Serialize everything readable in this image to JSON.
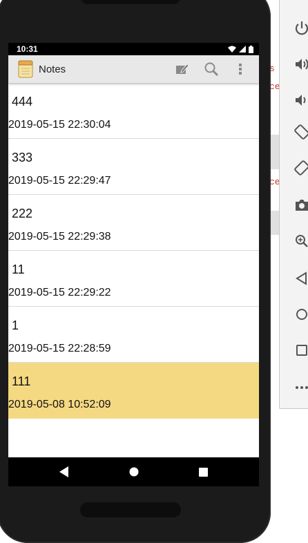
{
  "status": {
    "time": "10:31"
  },
  "app": {
    "title": "Notes"
  },
  "notes": [
    {
      "title": "444",
      "date": "2019-05-15 22:30:04"
    },
    {
      "title": "333",
      "date": "2019-05-15 22:29:47"
    },
    {
      "title": "222",
      "date": "2019-05-15 22:29:38"
    },
    {
      "title": "11",
      "date": "2019-05-15 22:29:22"
    },
    {
      "title": "1",
      "date": "2019-05-15 22:28:59"
    },
    {
      "title": "111",
      "date": "2019-05-08 10:52:09",
      "selected": true
    }
  ],
  "background_fragments": [
    "s",
    "ce",
    "ce"
  ],
  "colors": {
    "selected_row": "#f5d982",
    "appbar": "#e8e8e8",
    "status_bar": "#000000"
  },
  "icons": {
    "appbar": [
      "new-note-icon",
      "search-icon",
      "overflow-menu-icon"
    ],
    "navbar": [
      "back-icon",
      "home-icon",
      "recents-icon"
    ],
    "emulator_toolbar": [
      "power-icon",
      "volume-up-icon",
      "volume-down-icon",
      "rotate-left-icon",
      "rotate-right-icon",
      "camera-icon",
      "zoom-icon",
      "back-icon",
      "home-icon",
      "overview-icon",
      "more-icon"
    ]
  }
}
